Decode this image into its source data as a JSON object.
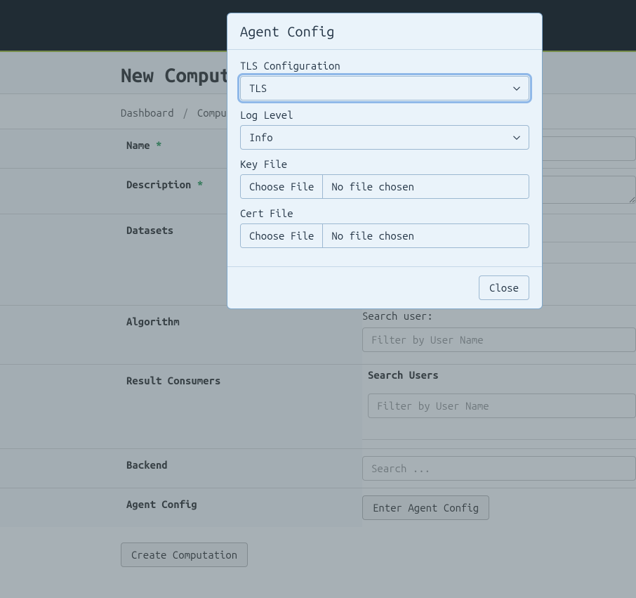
{
  "page": {
    "title": "New Computation"
  },
  "breadcrumb": {
    "item1": "Dashboard",
    "item2": "Computations"
  },
  "form": {
    "name_label": "Name",
    "description_label": "Description",
    "datasets_label": "Datasets",
    "algorithm_label": "Algorithm",
    "result_consumers_label": "Result Consumers",
    "backend_label": "Backend",
    "agent_config_label": "Agent Config",
    "search_user_label": "Search user:",
    "filter_placeholder": "Filter by User Name",
    "search_users_label": "Search Users",
    "backend_placeholder": "Search ...",
    "enter_agent_config": "Enter Agent Config",
    "create_button": "Create Computation"
  },
  "modal": {
    "title": "Agent Config",
    "tls_label": "TLS Configuration",
    "tls_value": "TLS",
    "log_label": "Log Level",
    "log_value": "Info",
    "key_file_label": "Key File",
    "cert_file_label": "Cert File",
    "choose_file": "Choose File",
    "no_file": "No file chosen",
    "close": "Close"
  }
}
